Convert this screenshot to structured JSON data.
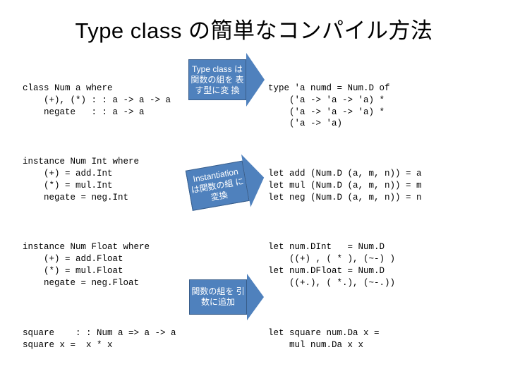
{
  "title": "Type class の簡単なコンパイル方法",
  "left": {
    "block1": "class Num a where\n    (+), (*) : : a -> a -> a\n    negate   : : a -> a",
    "block2": "instance Num Int where\n    (+) = add.Int\n    (*) = mul.Int\n    negate = neg.Int",
    "block3": "instance Num Float where\n    (+) = add.Float\n    (*) = mul.Float\n    negate = neg.Float",
    "block4": "square    : : Num a => a -> a\nsquare x =  x * x"
  },
  "arrows": {
    "a1": "Type class は\n関数の組を\n表す型に変\n換",
    "a2": "Instantiation\nは関数の組\nに変換",
    "a3": "関数の組を\n引数に追加"
  },
  "right": {
    "block1": "type 'a numd = Num.D of\n    ('a -> 'a -> 'a) *\n    ('a -> 'a -> 'a) *\n    ('a -> 'a)",
    "block2": "let add (Num.D (a, m, n)) = a\nlet mul (Num.D (a, m, n)) = m\nlet neg (Num.D (a, m, n)) = n",
    "block3": "let num.DInt   = Num.D\n    ((+) , ( * ), (~-) )\nlet num.DFloat = Num.D\n    ((+.), ( *.), (~-.))",
    "block4": "let square num.Da x =\n    mul num.Da x x"
  }
}
